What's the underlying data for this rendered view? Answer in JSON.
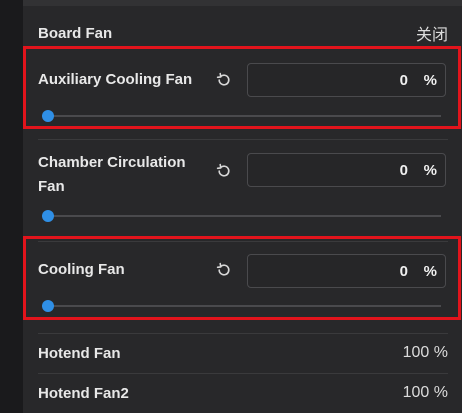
{
  "accent_color": "#2f8fe6",
  "highlight_color": "#e2141c",
  "board_fan": {
    "label": "Board Fan",
    "value": "关闭"
  },
  "fans": [
    {
      "label": "Auxiliary Cooling Fan",
      "value": "0",
      "unit": "%",
      "level": 0,
      "highlighted": true,
      "reset_icon": "reset-icon"
    },
    {
      "label_line1": "Chamber Circulation",
      "label_line2": "Fan",
      "value": "0",
      "unit": "%",
      "level": 0,
      "highlighted": false,
      "reset_icon": "reset-icon"
    },
    {
      "label": "Cooling Fan",
      "value": "0",
      "unit": "%",
      "level": 0,
      "highlighted": true,
      "reset_icon": "reset-icon"
    }
  ],
  "hotend_fan": {
    "label": "Hotend Fan",
    "value": "100 %"
  },
  "hotend_fan2": {
    "label": "Hotend Fan2",
    "value": "100 %"
  }
}
